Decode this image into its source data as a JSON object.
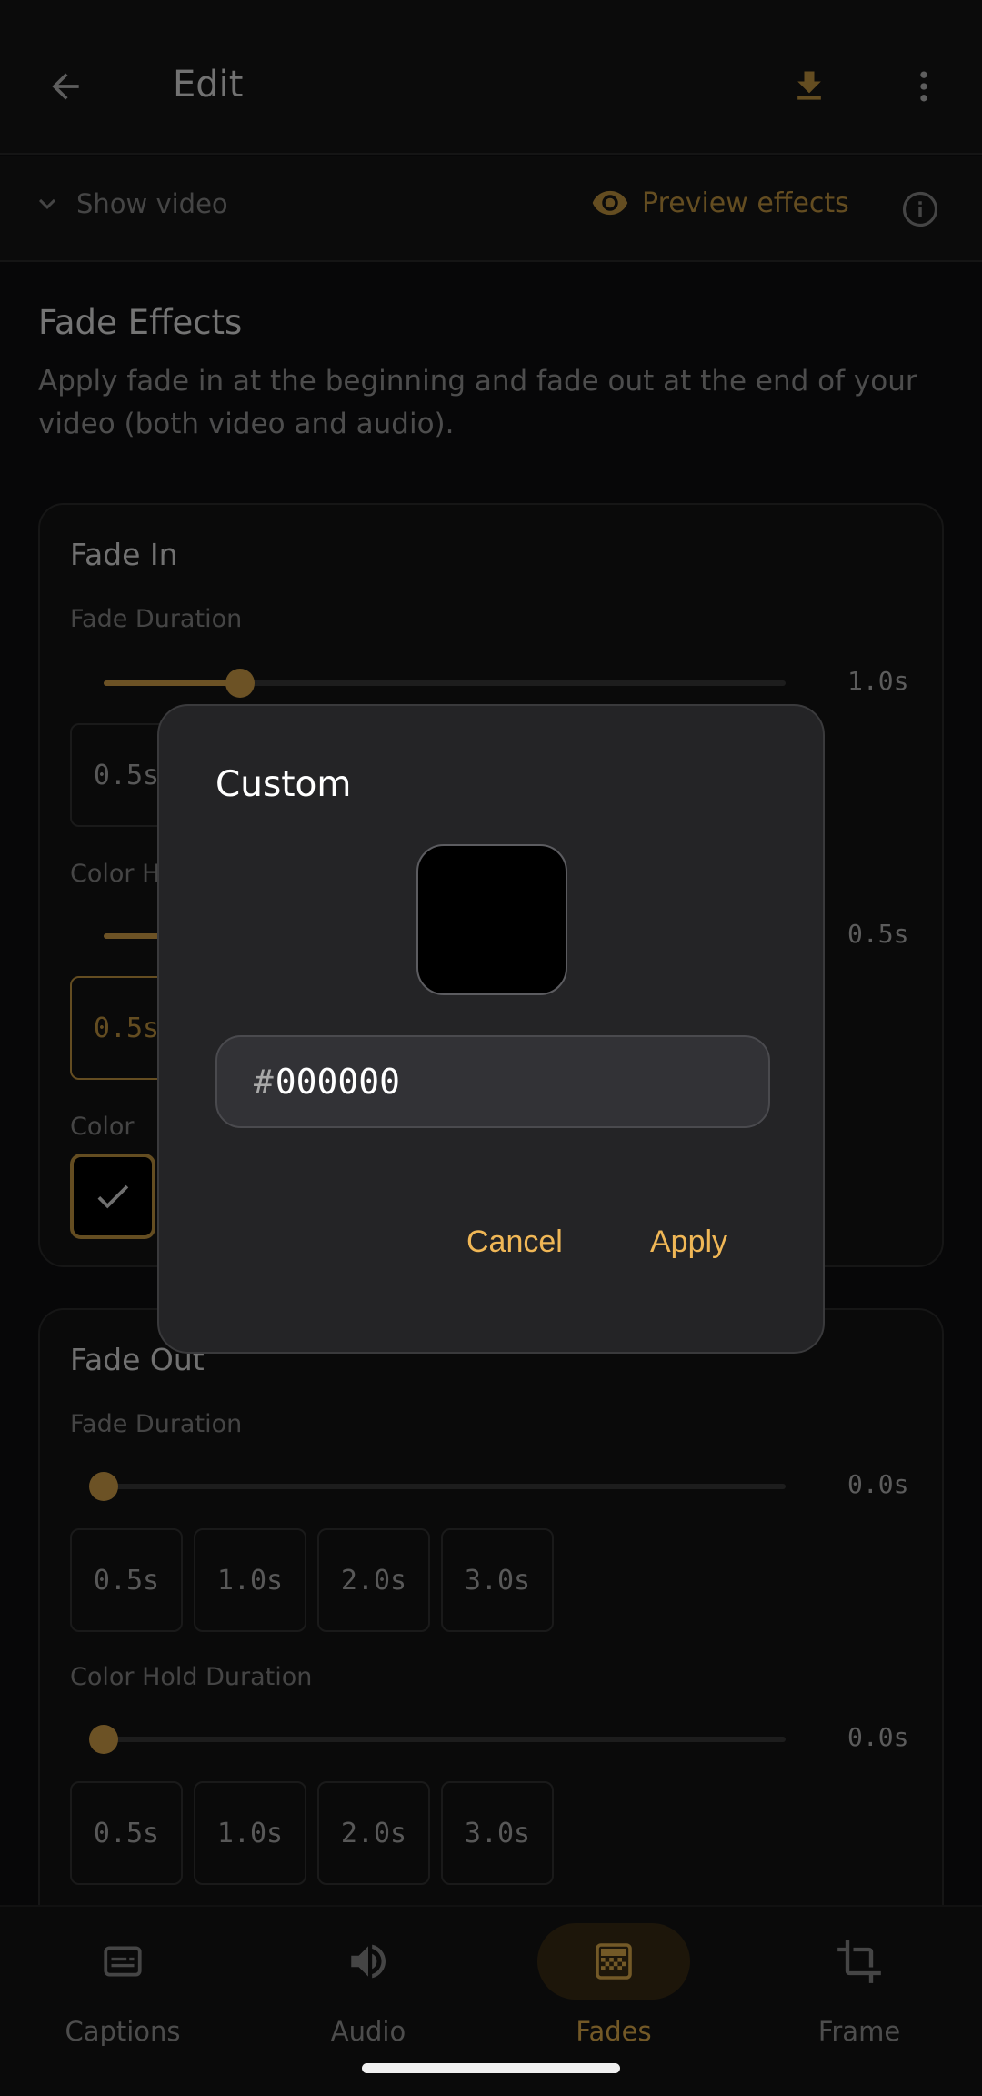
{
  "header": {
    "title": "Edit"
  },
  "subbar": {
    "show_video": "Show video",
    "preview_effects": "Preview effects"
  },
  "section": {
    "title": "Fade Effects",
    "description": "Apply fade in at the beginning and fade out at the end of your video (both video and audio)."
  },
  "fade_in": {
    "title": "Fade In",
    "duration_label": "Fade Duration",
    "duration_value": "1.0s",
    "duration_fraction": 0.2,
    "duration_chip": "0.5s",
    "hold_label_partial": "Color H",
    "hold_value": "0.5s",
    "hold_fraction": 0.1,
    "hold_chip": "0.5s",
    "color_label": "Color"
  },
  "fade_out": {
    "title": "Fade Out",
    "duration_label": "Fade Duration",
    "duration_value": "0.0s",
    "duration_fraction": 0.0,
    "duration_chips": [
      "0.5s",
      "1.0s",
      "2.0s",
      "3.0s"
    ],
    "hold_label": "Color Hold Duration",
    "hold_value": "0.0s",
    "hold_fraction": 0.0,
    "hold_chips": [
      "0.5s",
      "1.0s",
      "2.0s",
      "3.0s"
    ]
  },
  "nav": [
    {
      "label": "Captions",
      "icon": "captions-icon",
      "active": false
    },
    {
      "label": "Audio",
      "icon": "volume-icon",
      "active": false
    },
    {
      "label": "Fades",
      "icon": "fades-icon",
      "active": true
    },
    {
      "label": "Frame",
      "icon": "crop-icon",
      "active": false
    }
  ],
  "dialog": {
    "title": "Custom",
    "hex_prefix": "#",
    "hex_value": "000000",
    "swatch_color": "#000000",
    "cancel_label": "Cancel",
    "apply_label": "Apply"
  },
  "colors": {
    "accent": "#e7b24f",
    "accent_dim": "#c89a42"
  }
}
